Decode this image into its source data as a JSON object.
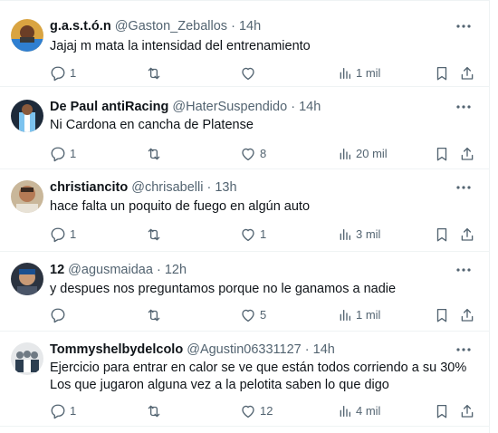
{
  "tweets": [
    {
      "name": "g.a.s.t.ó.n",
      "handle": "@Gaston_Zeballos",
      "dot": "·",
      "time": "14h",
      "lines": [
        "Jajaj m mata la intensidad del entrenamiento"
      ],
      "reply_count": "1",
      "retweet_count": "",
      "like_count": "",
      "view_count": "1 mil"
    },
    {
      "name": "De Paul antiRacing",
      "handle": "@HaterSuspendido",
      "dot": "·",
      "time": "14h",
      "lines": [
        "Ni Cardona en cancha de Platense"
      ],
      "reply_count": "1",
      "retweet_count": "",
      "like_count": "8",
      "view_count": "20 mil"
    },
    {
      "name": "christiancito",
      "handle": "@chrisabelli",
      "dot": "·",
      "time": "13h",
      "lines": [
        "hace falta un poquito de fuego en algún auto"
      ],
      "reply_count": "1",
      "retweet_count": "",
      "like_count": "1",
      "view_count": "3 mil"
    },
    {
      "name": "12",
      "handle": "@agusmaidaa",
      "dot": "·",
      "time": "12h",
      "lines": [
        "y despues nos preguntamos porque no le ganamos a nadie"
      ],
      "reply_count": "",
      "retweet_count": "",
      "like_count": "5",
      "view_count": "1 mil"
    },
    {
      "name": "Tommyshelbydelcolo",
      "handle": "@Agustin06331127",
      "dot": "·",
      "time": "14h",
      "lines": [
        "Ejercicio para entrar en calor se ve que están todos corriendo a su 30%",
        "Los que jugaron alguna vez a la pelotita saben lo que digo"
      ],
      "reply_count": "1",
      "retweet_count": "",
      "like_count": "12",
      "view_count": "4 mil"
    }
  ],
  "icons": {
    "reply": "reply-icon",
    "retweet": "retweet-icon",
    "like": "like-icon",
    "views": "views-icon",
    "bookmark": "bookmark-icon",
    "share": "share-icon",
    "more": "more-icon"
  },
  "colors": {
    "text": "#0f1419",
    "muted": "#536471",
    "border": "#eff3f4"
  }
}
